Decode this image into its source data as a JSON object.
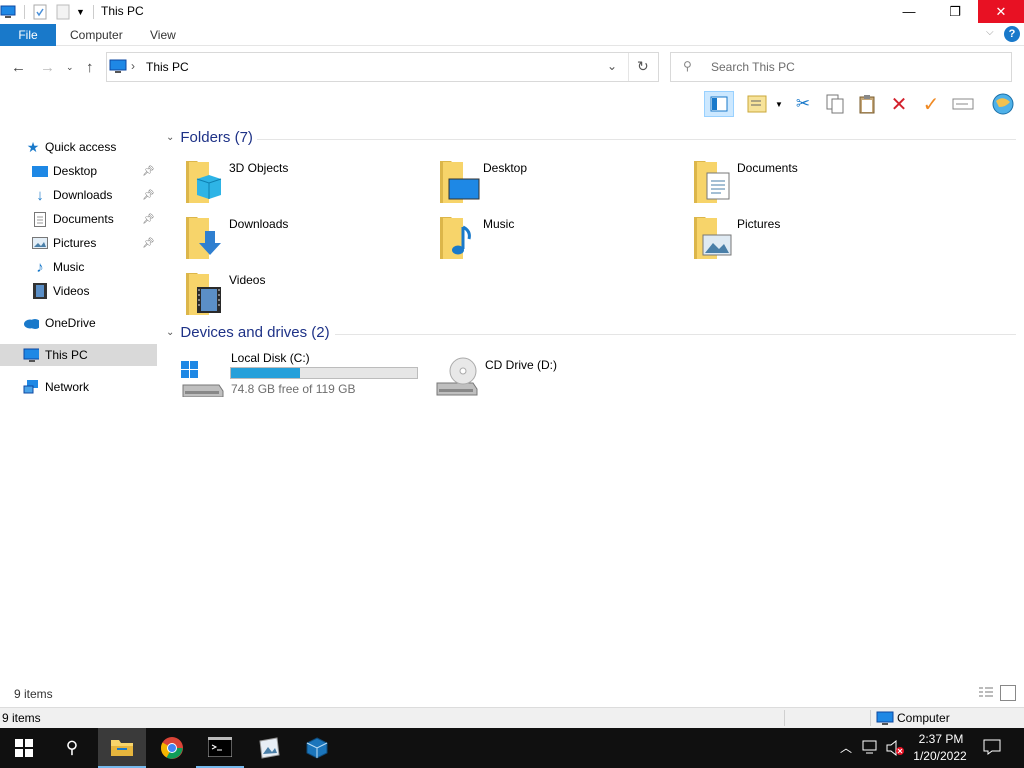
{
  "window": {
    "title": "This PC",
    "close_glyph": "✕",
    "maximize_glyph": "❐",
    "minimize_glyph": "—"
  },
  "ribbon": {
    "tabs": [
      "File",
      "Computer",
      "View"
    ],
    "help_glyph": "?"
  },
  "address": {
    "path": "This PC",
    "search_placeholder": "Search This PC"
  },
  "nav_pane": {
    "quick_access": "Quick access",
    "items": [
      {
        "label": "Desktop",
        "pinned": true
      },
      {
        "label": "Downloads",
        "pinned": true
      },
      {
        "label": "Documents",
        "pinned": true
      },
      {
        "label": "Pictures",
        "pinned": true
      },
      {
        "label": "Music",
        "pinned": false
      },
      {
        "label": "Videos",
        "pinned": false
      }
    ],
    "onedrive": "OneDrive",
    "this_pc": "This PC",
    "network": "Network"
  },
  "folders_group": {
    "header": "Folders (7)",
    "items": [
      "3D Objects",
      "Desktop",
      "Documents",
      "Downloads",
      "Music",
      "Pictures",
      "Videos"
    ]
  },
  "drives_group": {
    "header": "Devices and drives (2)",
    "drives": [
      {
        "name": "Local Disk (C:)",
        "free_text": "74.8 GB free of 119 GB",
        "used_fraction": 0.37
      },
      {
        "name": "CD Drive (D:)"
      }
    ]
  },
  "status": {
    "item_count": "9 items",
    "bottom_count": "9 items",
    "location": "Computer"
  },
  "taskbar": {
    "time": "2:37 PM",
    "date": "1/20/2022"
  },
  "colors": {
    "accent": "#1979ca",
    "group_header": "#1e3287",
    "progress": "#26a0da",
    "close_red": "#e81123"
  }
}
